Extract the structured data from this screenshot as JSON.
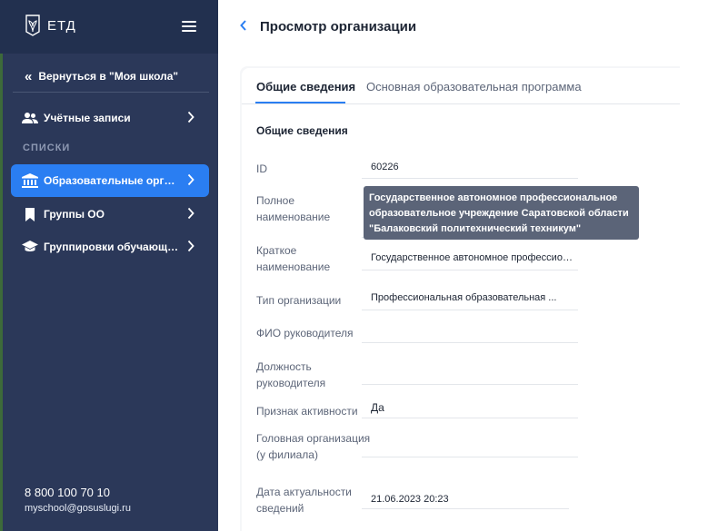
{
  "app": {
    "logo_text": "ЕТД"
  },
  "sidebar": {
    "back_label": "Вернуться в \"Моя школа\"",
    "accounts_label": "Учётные записи",
    "section_label": "СПИСКИ",
    "items": [
      {
        "label": "Образовательные организации",
        "active": true
      },
      {
        "label": "Группы ОО",
        "active": false
      },
      {
        "label": "Группировки обучающихся",
        "active": false
      }
    ],
    "phone": "8 800 100 70 10",
    "email": "myschool@gosuslugi.ru"
  },
  "header": {
    "title": "Просмотр организации"
  },
  "tabs": [
    {
      "label": "Общие сведения",
      "active": true
    },
    {
      "label": "Основная образовательная программа",
      "active": false
    }
  ],
  "section_title": "Общие сведения",
  "fields": {
    "id": {
      "label": "ID",
      "value": "60226"
    },
    "full_name": {
      "label_line1": "Полное",
      "label_line2": "наименование",
      "value": ""
    },
    "short_name": {
      "label_line1": "Краткое",
      "label_line2": "наименование",
      "value": "Государственное автономное профессиона..."
    },
    "org_type": {
      "label": "Тип организации",
      "value": "Профессиональная образовательная ..."
    },
    "head_fio": {
      "label": "ФИО руководителя",
      "value": ""
    },
    "head_position": {
      "label_line1": "Должность",
      "label_line2": "руководителя",
      "value": ""
    },
    "active_flag": {
      "label": "Признак активности",
      "value": "Да"
    },
    "parent_org": {
      "label_line1": "Головная организация",
      "label_line2": "(у филиала)",
      "value": ""
    },
    "actual_date": {
      "label_line1": "Дата актуальности",
      "label_line2": "сведений",
      "value": "21.06.2023 20:23"
    }
  },
  "tooltip": {
    "line1": "Государственное автономное профессиональное",
    "line2": "образовательное учреждение Саратовской области",
    "line3": "\"Балаковский политехнический техникум\""
  },
  "colors": {
    "sidebar_bg": "#2b3859",
    "accent": "#2a7ef2",
    "tooltip_bg": "#5b6478"
  }
}
